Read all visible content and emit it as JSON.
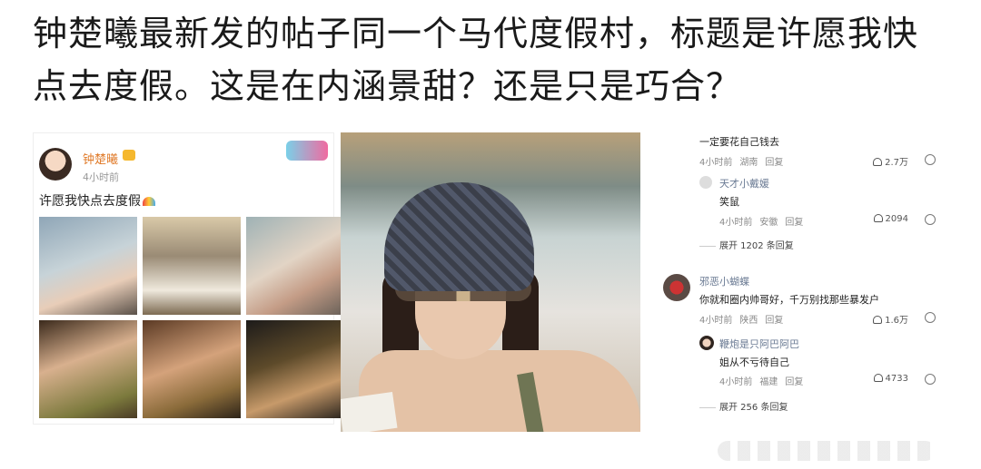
{
  "headline": "钟楚曦最新发的帖子同一个马代度假村，标题是许愿我快点去度假。这是在内涵景甜？还是只是巧合？",
  "post": {
    "author": "钟楚曦",
    "time": "4小时前",
    "text": "许愿我快点去度假",
    "thumbnails": [
      "photo-1",
      "photo-2",
      "photo-3",
      "photo-4",
      "photo-5",
      "photo-6"
    ]
  },
  "comments": {
    "top_fragment": {
      "text": "一定要花自己钱去",
      "time": "4小时前",
      "location": "湖南",
      "reply": "回复",
      "likes": "2.7万"
    },
    "reply1": {
      "name": "天才小戴媛",
      "text": "笑鼠",
      "time": "4小时前",
      "location": "安徽",
      "reply": "回复",
      "likes": "2094"
    },
    "expand1": "展开 1202 条回复",
    "comment2": {
      "name": "邪恶小蝴蝶",
      "text": "你就和圈内帅哥好，千万别找那些暴发户",
      "time": "4小时前",
      "location": "陕西",
      "reply": "回复",
      "likes": "1.6万"
    },
    "reply2": {
      "name": "鞭炮是只阿巴阿巴",
      "text": "姐从不亏待自己",
      "time": "4小时前",
      "location": "福建",
      "reply": "回复",
      "likes": "4733"
    },
    "expand2": "展开 256 条回复"
  }
}
